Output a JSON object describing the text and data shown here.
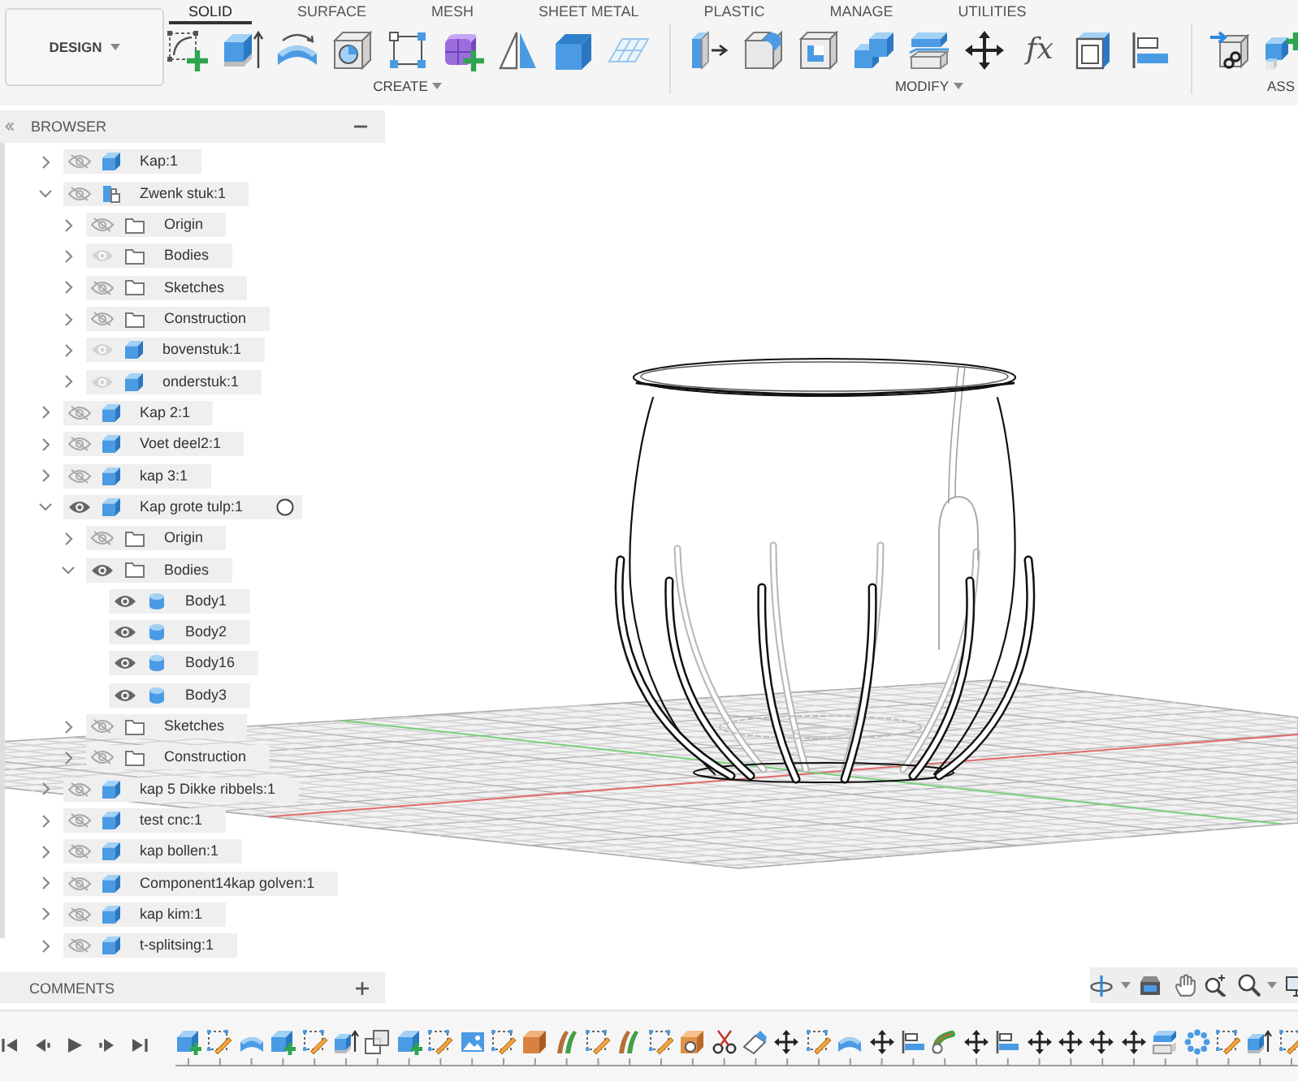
{
  "toolbar": {
    "workspace": "DESIGN",
    "tabs": [
      {
        "label": "SOLID",
        "selected": true
      },
      {
        "label": "SURFACE",
        "selected": false
      },
      {
        "label": "MESH",
        "selected": false
      },
      {
        "label": "SHEET METAL",
        "selected": false
      },
      {
        "label": "PLASTIC",
        "selected": false
      },
      {
        "label": "MANAGE",
        "selected": false
      },
      {
        "label": "UTILITIES",
        "selected": false
      }
    ],
    "groups": [
      {
        "label": "CREATE",
        "dropdown": true
      },
      {
        "label": "MODIFY",
        "dropdown": true,
        "formula_glyph": "fx"
      },
      {
        "label": "ASS",
        "dropdown": false
      }
    ]
  },
  "browser": {
    "title": "BROWSER",
    "items": [
      {
        "label": "Kap:1",
        "kind": "component",
        "visible": false,
        "expanded": false,
        "hovered": false
      },
      {
        "label": "Zwenk stuk:1",
        "kind": "assembly",
        "visible": false,
        "expanded": true,
        "hovered": false,
        "children": [
          {
            "label": "Origin",
            "kind": "folder",
            "visible": false,
            "expanded": false
          },
          {
            "label": "Bodies",
            "kind": "folder",
            "visible": true,
            "expanded": false
          },
          {
            "label": "Sketches",
            "kind": "folder",
            "visible": false,
            "expanded": false
          },
          {
            "label": "Construction",
            "kind": "folder",
            "visible": false,
            "expanded": false
          },
          {
            "label": "bovenstuk:1",
            "kind": "component",
            "visible": true,
            "expanded": false
          },
          {
            "label": "onderstuk:1",
            "kind": "component",
            "visible": true,
            "expanded": false
          }
        ]
      },
      {
        "label": "Kap 2:1",
        "kind": "component",
        "visible": false,
        "expanded": false,
        "hovered": false
      },
      {
        "label": "Voet deel2:1",
        "kind": "component",
        "visible": false,
        "expanded": false,
        "hovered": false
      },
      {
        "label": "kap 3:1",
        "kind": "component",
        "visible": false,
        "expanded": false,
        "hovered": false
      },
      {
        "label": "Kap grote tulp:1",
        "kind": "component",
        "visible": true,
        "expanded": true,
        "hovered": true,
        "children": [
          {
            "label": "Origin",
            "kind": "folder",
            "visible": false,
            "expanded": false
          },
          {
            "label": "Bodies",
            "kind": "folder",
            "visible": true,
            "expanded": true,
            "children": [
              {
                "label": "Body1",
                "kind": "body",
                "visible": true
              },
              {
                "label": "Body2",
                "kind": "body",
                "visible": true
              },
              {
                "label": "Body16",
                "kind": "body",
                "visible": true
              },
              {
                "label": "Body3",
                "kind": "body",
                "visible": true
              }
            ]
          },
          {
            "label": "Sketches",
            "kind": "folder",
            "visible": false,
            "expanded": false
          },
          {
            "label": "Construction",
            "kind": "folder",
            "visible": false,
            "expanded": false
          }
        ]
      },
      {
        "label": "kap 5 Dikke ribbels:1",
        "kind": "component",
        "visible": false,
        "expanded": false,
        "hovered": false
      },
      {
        "label": "test cnc:1",
        "kind": "component",
        "visible": false,
        "expanded": false,
        "hovered": false
      },
      {
        "label": "kap bollen:1",
        "kind": "component",
        "visible": false,
        "expanded": false,
        "hovered": false
      },
      {
        "label": "Component14kap golven:1",
        "kind": "component",
        "visible": false,
        "expanded": false,
        "hovered": false
      },
      {
        "label": "kap kim:1",
        "kind": "component",
        "visible": false,
        "expanded": false,
        "hovered": false
      },
      {
        "label": "t-splitsing:1",
        "kind": "component",
        "visible": false,
        "expanded": false,
        "hovered": false
      }
    ]
  },
  "comments": {
    "title": "COMMENTS"
  }
}
